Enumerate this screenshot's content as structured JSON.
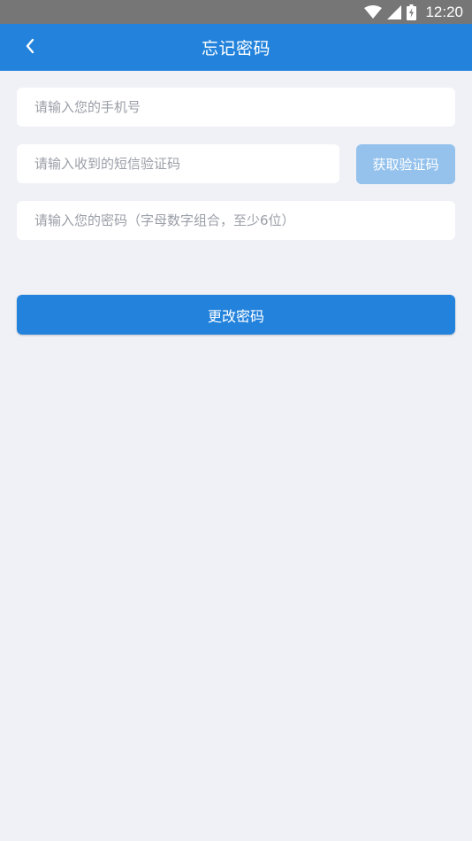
{
  "status_bar": {
    "time": "12:20",
    "icons": [
      "wifi-icon",
      "signal-icon",
      "battery-icon"
    ]
  },
  "header": {
    "title": "忘记密码",
    "back_icon": "chevron-left-icon"
  },
  "form": {
    "phone_placeholder": "请输入您的手机号",
    "code_placeholder": "请输入收到的短信验证码",
    "get_code_label": "获取验证码",
    "password_placeholder": "请输入您的密码（字母数字组合，至少6位）",
    "submit_label": "更改密码"
  },
  "colors": {
    "primary": "#2383dc",
    "primary_disabled": "#94c2ec",
    "background": "#eff1f6",
    "status_bar": "#767676"
  }
}
